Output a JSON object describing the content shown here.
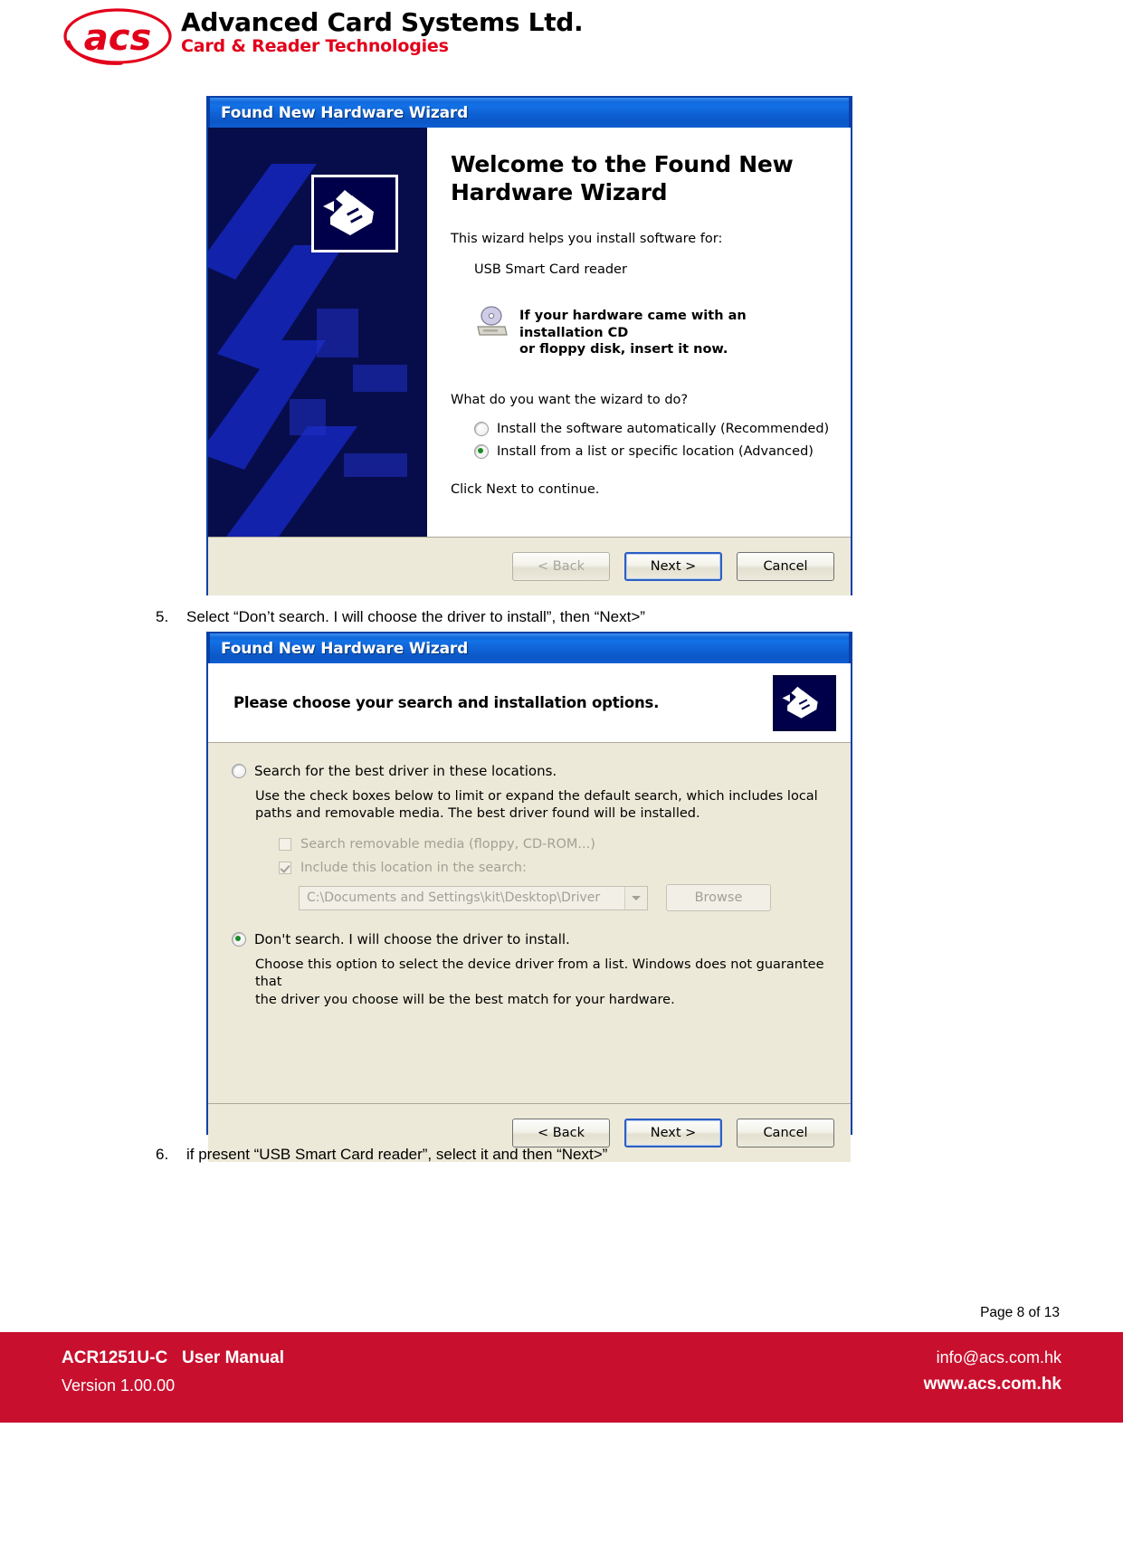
{
  "header": {
    "company_name": "Advanced Card Systems Ltd.",
    "tagline": "Card & Reader Technologies",
    "logo_text": "acs",
    "brand_red": "#e2001a"
  },
  "dialog_welcome": {
    "title": "Found New Hardware Wizard",
    "heading": "Welcome to the Found New Hardware Wizard",
    "intro": "This wizard helps you install software for:",
    "device": "USB Smart Card reader",
    "cd_note_line1": "If your hardware came with an installation CD",
    "cd_note_line2": "or floppy disk, insert it now.",
    "question": "What do you want the wizard to do?",
    "options": [
      {
        "label": "Install the software automatically (Recommended)",
        "selected": false
      },
      {
        "label": "Install from a list or specific location (Advanced)",
        "selected": true
      }
    ],
    "footer_note": "Click Next to continue.",
    "buttons": [
      {
        "label": "< Back",
        "state": "disabled"
      },
      {
        "label": "Next >",
        "state": "default"
      },
      {
        "label": "Cancel",
        "state": "normal"
      }
    ]
  },
  "dialog_options": {
    "title": "Found New Hardware Wizard",
    "header_title": "Please choose your search and installation options.",
    "option_search": {
      "label": "Search for the best driver in these locations.",
      "selected": false,
      "description_line1": "Use the check boxes below to limit or expand the default search, which includes local",
      "description_line2": "paths and removable media. The best driver found will be installed."
    },
    "checkboxes": [
      {
        "label": "Search removable media (floppy, CD-ROM...)",
        "checked": false
      },
      {
        "label": "Include this location in the search:",
        "checked": true
      }
    ],
    "path_value": "C:\\Documents and Settings\\kit\\Desktop\\Driver",
    "browse_label": "Browse",
    "option_dont_search": {
      "label": "Don't search. I will choose the driver to install.",
      "selected": true,
      "description_line1": "Choose this option to select the device driver from a list.  Windows does not guarantee that",
      "description_line2": "the driver you choose will be the best match for your hardware."
    },
    "buttons": [
      {
        "label": "< Back",
        "state": "normal"
      },
      {
        "label": "Next >",
        "state": "default"
      },
      {
        "label": "Cancel",
        "state": "normal"
      }
    ]
  },
  "steps": [
    {
      "number": "5.",
      "text": "Select “Don’t search. I will choose the driver to install”, then “Next>”"
    },
    {
      "number": "6.",
      "text": "if present “USB Smart Card reader”, select it and then “Next>”"
    }
  ],
  "page_number": "Page 8 of 13",
  "footer": {
    "product": "ACR1251U-C",
    "doc_type": "User Manual",
    "version": "Version 1.00.00",
    "email": "info@acs.com.hk",
    "website": "www.acs.com.hk",
    "bar_color": "#c8102e"
  }
}
